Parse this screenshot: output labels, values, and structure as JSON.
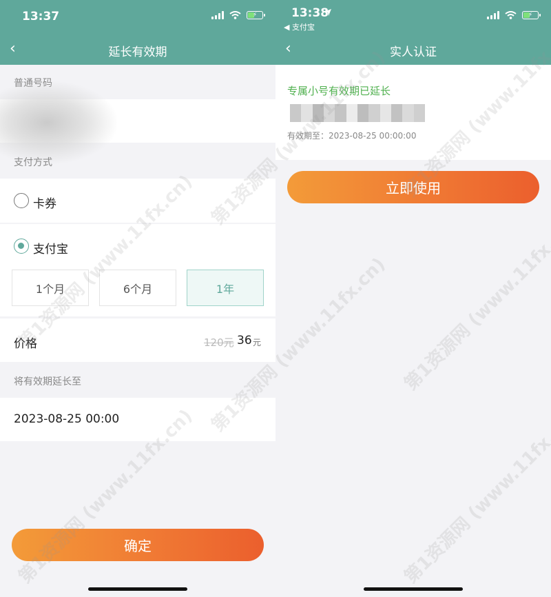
{
  "left": {
    "status": {
      "time": "13:37"
    },
    "nav": {
      "title": "延长有效期"
    },
    "section_number": "普通号码",
    "section_payment": "支付方式",
    "option_card": "卡券",
    "option_alipay": "支付宝",
    "durations": [
      "1个月",
      "6个月",
      "1年"
    ],
    "price_label": "价格",
    "price_old": "120元",
    "price_new": "36",
    "price_unit": "元",
    "extend_label": "将有效期延长至",
    "extend_date": "2023-08-25 00:00",
    "confirm_label": "确定"
  },
  "right": {
    "status": {
      "time": "13:38",
      "back_app": "◀ 支付宝"
    },
    "nav": {
      "title": "实人认证"
    },
    "success": "专属小号有效期已延长",
    "expire": "有效期至：2023-08-25 00:00:00",
    "use_label": "立即使用"
  },
  "watermark": "第1资源网 (www.11fx.cn)",
  "colors": {
    "primary": "#5fa89b",
    "success": "#4fb04e",
    "button_start": "#f39b39",
    "button_end": "#eb5f2d"
  },
  "icons": [
    "back-arrow-icon",
    "signal-icon",
    "wifi-icon",
    "battery-icon",
    "location-arrow-icon"
  ]
}
